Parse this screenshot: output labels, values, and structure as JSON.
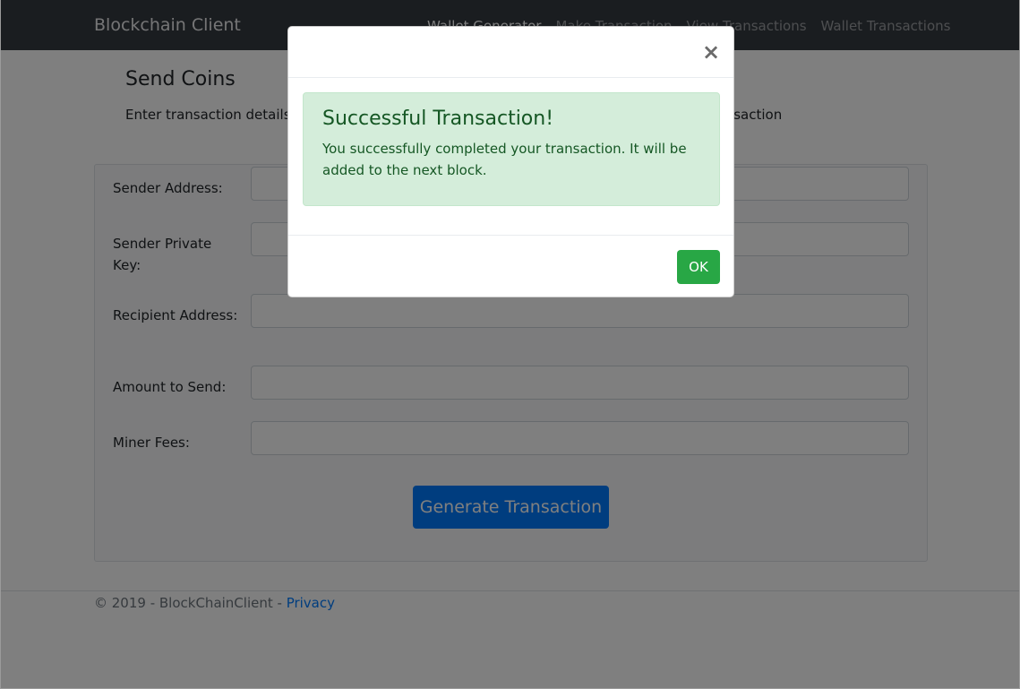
{
  "navbar": {
    "brand": "Blockchain Client",
    "links": [
      {
        "label": "Wallet Generator",
        "active": true
      },
      {
        "label": "Make Transaction",
        "active": false
      },
      {
        "label": "View Transactions",
        "active": false
      },
      {
        "label": "Wallet Transactions",
        "active": false
      }
    ]
  },
  "page": {
    "title": "Send Coins",
    "subtitle": "Enter transaction details and click on \"Generate Transaction\" button to generate your transaction"
  },
  "form": {
    "fields": [
      {
        "label": "Sender Address:",
        "value": ""
      },
      {
        "label": "Sender Private Key:",
        "value": ""
      },
      {
        "label": "Recipient Address:",
        "value": ""
      },
      {
        "label": "Amount to Send:",
        "value": ""
      },
      {
        "label": "Miner Fees:",
        "value": ""
      }
    ],
    "submit_label": "Generate Transaction"
  },
  "footer": {
    "text": "© 2019 - BlockChainClient - ",
    "link": "Privacy"
  },
  "modal": {
    "close_symbol": "×",
    "alert_title": "Successful Transaction!",
    "alert_text": "You successfully completed your transaction. It will be added to the next block.",
    "ok_label": "OK"
  },
  "colors": {
    "navbar": "#343a40",
    "primary": "#007bff",
    "success": "#28a745",
    "alert_bg": "#d4edda",
    "alert_text": "#155724"
  }
}
